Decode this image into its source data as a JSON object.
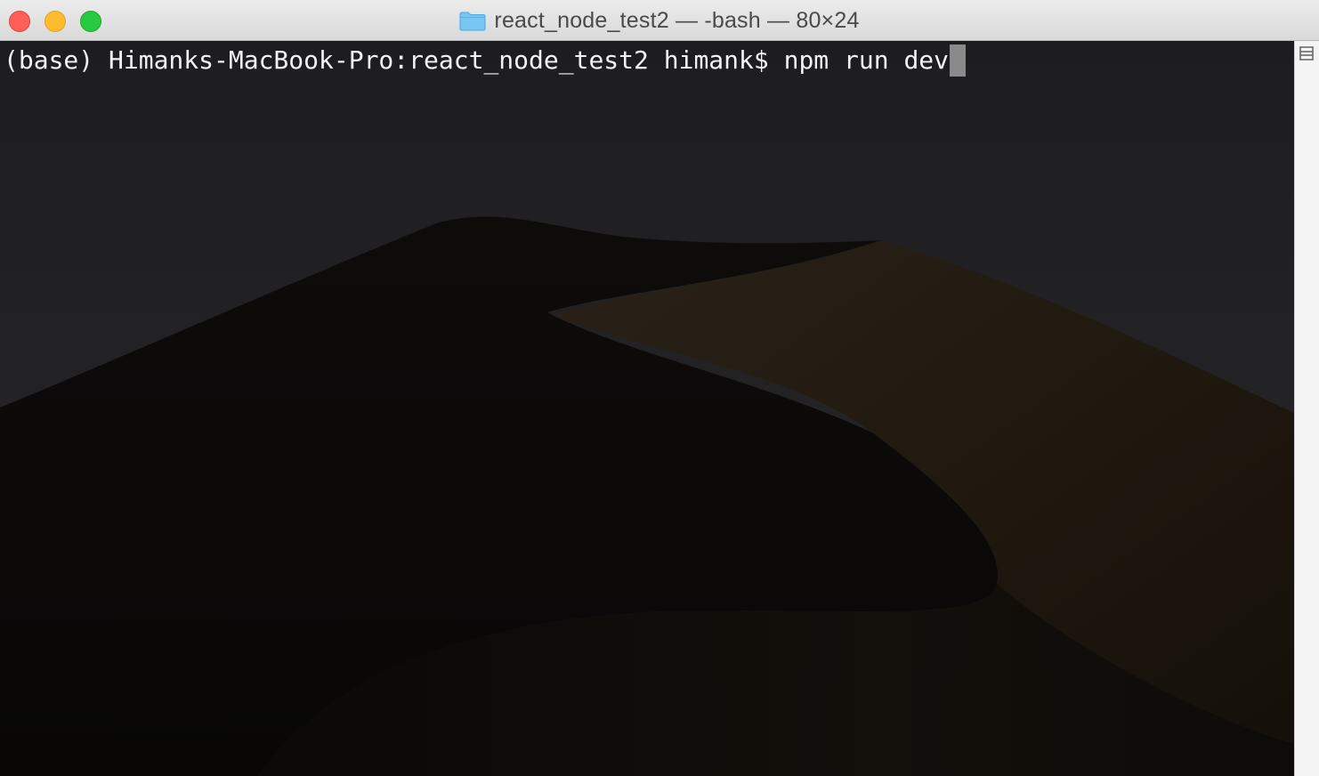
{
  "window": {
    "title": "react_node_test2 — -bash — 80×24",
    "title_icon": "folder-icon",
    "controls": [
      "close",
      "minimize",
      "zoom"
    ]
  },
  "terminal": {
    "prompt": "(base) Himanks-MacBook-Pro:react_node_test2 himank$ ",
    "command": "npm run dev",
    "cursor": "block"
  },
  "scrollbar": {
    "icon": "split-pane-icon"
  },
  "colors": {
    "close": "#fe5f57",
    "minimize": "#febc2e",
    "zoom": "#28c840",
    "folder": "#6cc4f5",
    "terminal_text": "#f2f2f2"
  }
}
